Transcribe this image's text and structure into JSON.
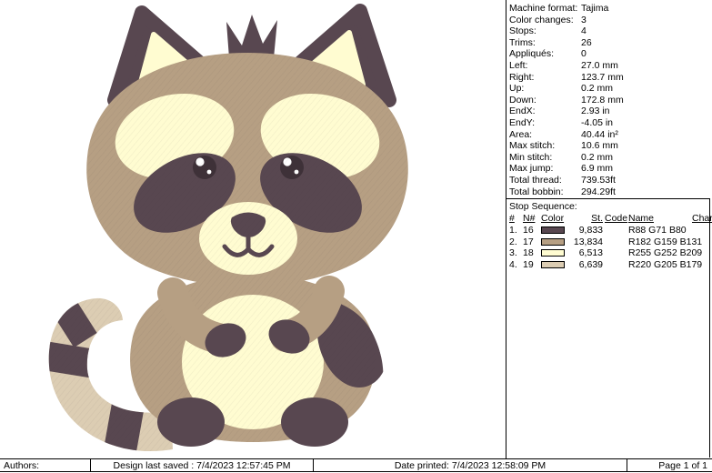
{
  "design": {
    "description": "Cute raccoon embroidery design",
    "colors": {
      "dark": "#584750",
      "tan": "#B69F83",
      "cream": "#FFFCD1",
      "beige": "#DCCDB3",
      "eye": "#3E3138"
    }
  },
  "panel": {
    "fields": [
      {
        "label": "Machine format:",
        "value": "Tajima"
      },
      {
        "label": "Color changes:",
        "value": "3"
      },
      {
        "label": "Stops:",
        "value": "4"
      },
      {
        "label": "Trims:",
        "value": "26"
      },
      {
        "label": "Appliqués:",
        "value": "0"
      },
      {
        "label": "Left:",
        "value": "27.0 mm"
      },
      {
        "label": "Right:",
        "value": "123.7 mm"
      },
      {
        "label": "Up:",
        "value": "0.2 mm"
      },
      {
        "label": "Down:",
        "value": "172.8 mm"
      },
      {
        "label": "EndX:",
        "value": "2.93 in"
      },
      {
        "label": "EndY:",
        "value": "-4.05 in"
      },
      {
        "label": "Area:",
        "value": "40.44 in²"
      },
      {
        "label": "Max stitch:",
        "value": "10.6 mm"
      },
      {
        "label": "Min stitch:",
        "value": "0.2 mm"
      },
      {
        "label": "Max jump:",
        "value": "6.9 mm"
      },
      {
        "label": "Total thread:",
        "value": "739.53ft"
      },
      {
        "label": "Total bobbin:",
        "value": "294.29ft"
      }
    ],
    "stop_sequence": {
      "title": "Stop Sequence:",
      "headers": [
        "#",
        "N#",
        "Color",
        "St.",
        "Code",
        "Name",
        "Chart"
      ],
      "rows": [
        {
          "num": "1.",
          "n": "16",
          "color": "#584750",
          "st": "9,833",
          "code": "",
          "name": "R88 G71 B80"
        },
        {
          "num": "2.",
          "n": "17",
          "color": "#B69F83",
          "st": "13,834",
          "code": "",
          "name": "R182 G159 B131"
        },
        {
          "num": "3.",
          "n": "18",
          "color": "#FFFCD1",
          "st": "6,513",
          "code": "",
          "name": "R255 G252 B209"
        },
        {
          "num": "4.",
          "n": "19",
          "color": "#DCCDB3",
          "st": "6,639",
          "code": "",
          "name": "R220 G205 B179"
        }
      ]
    }
  },
  "statusbar": {
    "authors": "Authors:",
    "last_saved": "Design last saved : 7/4/2023 12:57:45 PM",
    "date_printed": "Date printed: 7/4/2023 12:58:09 PM",
    "page": "Page 1 of 1"
  }
}
